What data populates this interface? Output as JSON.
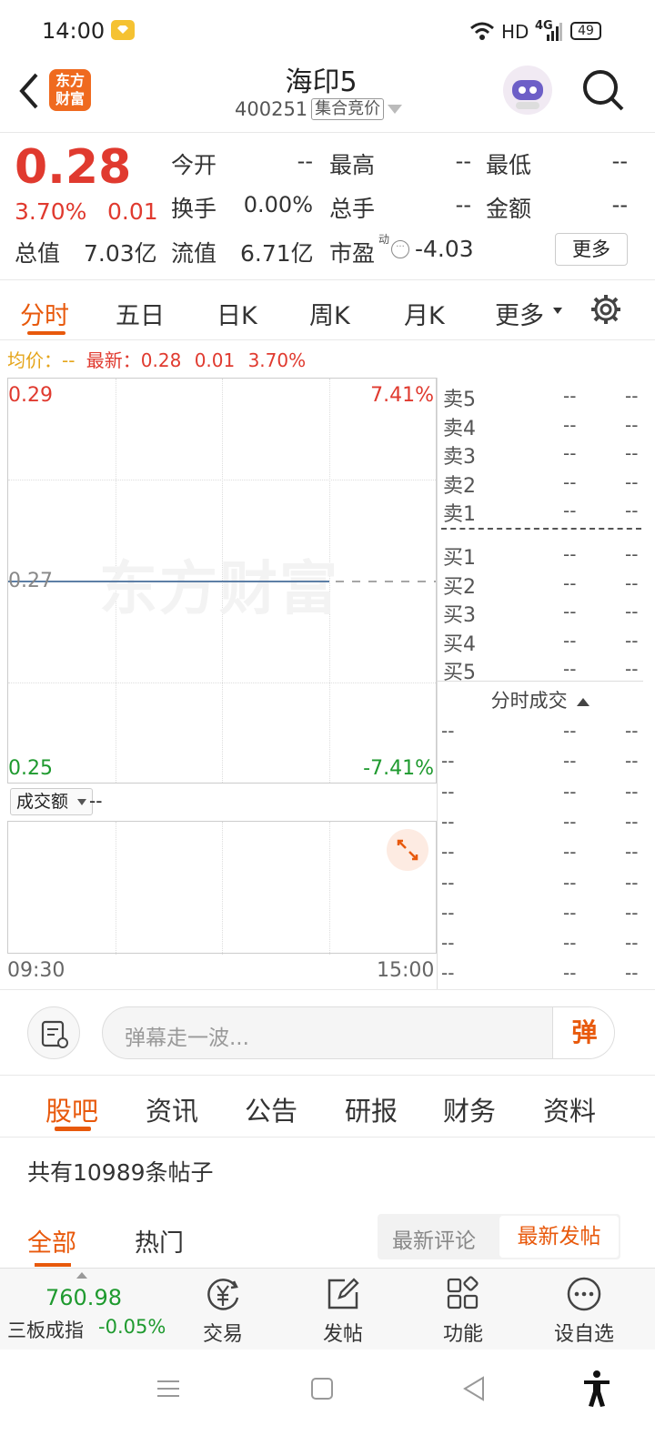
{
  "status": {
    "time": "14:00",
    "network": "HD",
    "signal": "4G",
    "battery": "49"
  },
  "header": {
    "logo_text": "东方财富",
    "title": "海印5",
    "code": "400251",
    "session_badge": "集合竞价"
  },
  "quote": {
    "price": "0.28",
    "change_pct": "3.70%",
    "change": "0.01",
    "rows": [
      [
        {
          "label": "今开",
          "value": "--"
        },
        {
          "label": "最高",
          "value": "--"
        },
        {
          "label": "最低",
          "value": "--"
        }
      ],
      [
        {
          "label": "换手",
          "value": "0.00%"
        },
        {
          "label": "总手",
          "value": "--"
        },
        {
          "label": "金额",
          "value": "--"
        }
      ]
    ],
    "total_value_label": "总值",
    "total_value": "7.03亿",
    "float_value_label": "流值",
    "float_value": "6.71亿",
    "pe_label": "市盈",
    "pe_sup": "动",
    "pe_value": "-4.03",
    "more_button": "更多"
  },
  "chart_tabs": [
    "分时",
    "五日",
    "日K",
    "周K",
    "月K",
    "更多"
  ],
  "info_line": {
    "avg_label": "均价：",
    "avg_value": "--",
    "latest_label": "最新：",
    "latest_price": "0.28",
    "latest_change": "0.01",
    "latest_pct": "3.70%"
  },
  "chart_data": {
    "type": "line",
    "y_left_labels": {
      "top": "0.29",
      "mid": "0.27",
      "bottom": "0.25"
    },
    "y_right_labels": {
      "top": "7.41%",
      "bottom": "-7.41%"
    },
    "x_labels": {
      "start": "09:30",
      "end": "15:00"
    },
    "ylim": [
      0.25,
      0.29
    ],
    "series": [
      {
        "values": [
          0.27,
          0.27
        ]
      }
    ],
    "prev_close": 0.27,
    "watermark": "东方财富",
    "volume_selector": "成交额",
    "volume_value": "--"
  },
  "orderbook": {
    "asks": [
      {
        "label": "卖5",
        "price": "--",
        "vol": "--"
      },
      {
        "label": "卖4",
        "price": "--",
        "vol": "--"
      },
      {
        "label": "卖3",
        "price": "--",
        "vol": "--"
      },
      {
        "label": "卖2",
        "price": "--",
        "vol": "--"
      },
      {
        "label": "卖1",
        "price": "--",
        "vol": "--"
      }
    ],
    "bids": [
      {
        "label": "买1",
        "price": "--",
        "vol": "--"
      },
      {
        "label": "买2",
        "price": "--",
        "vol": "--"
      },
      {
        "label": "买3",
        "price": "--",
        "vol": "--"
      },
      {
        "label": "买4",
        "price": "--",
        "vol": "--"
      },
      {
        "label": "买5",
        "price": "--",
        "vol": "--"
      }
    ],
    "ticks_title": "分时成交",
    "ticks": [
      [
        "--",
        "--",
        "--"
      ],
      [
        "--",
        "--",
        "--"
      ],
      [
        "--",
        "--",
        "--"
      ],
      [
        "--",
        "--",
        "--"
      ],
      [
        "--",
        "--",
        "--"
      ],
      [
        "--",
        "--",
        "--"
      ],
      [
        "--",
        "--",
        "--"
      ],
      [
        "--",
        "--",
        "--"
      ],
      [
        "--",
        "--",
        "--"
      ]
    ]
  },
  "danmaku": {
    "placeholder": "弹幕走一波...",
    "send_label": "弹"
  },
  "nav_tabs": [
    "股吧",
    "资讯",
    "公告",
    "研报",
    "财务",
    "资料"
  ],
  "forum": {
    "post_count": "共有10989条帖子",
    "filter_tabs": [
      "全部",
      "热门"
    ],
    "sort_options": [
      "最新评论",
      "最新发帖"
    ]
  },
  "bottom_bar": {
    "index_value": "760.98",
    "index_name": "三板成指",
    "index_change": "-0.05%",
    "items": [
      {
        "label": "交易",
        "icon": "trade-icon"
      },
      {
        "label": "发帖",
        "icon": "edit-icon"
      },
      {
        "label": "功能",
        "icon": "grid-icon"
      },
      {
        "label": "设自选",
        "icon": "more-icon"
      }
    ]
  },
  "colors": {
    "accent": "#e8590c",
    "up": "#e03a2f",
    "down": "#1f9a2f"
  }
}
